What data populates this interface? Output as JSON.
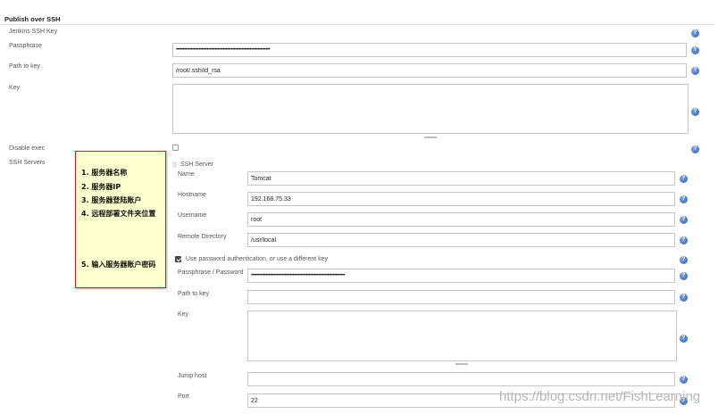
{
  "section": {
    "title": "Publish over SSH"
  },
  "global": {
    "jenkins_ssh_key_label": "Jenkins SSH Key",
    "passphrase_label": "Passphrase",
    "passphrase_value": "••••••••••••••••••••••••••••••••••••••••••••••••••••••••••••••••••••••",
    "path_to_key_label": "Path to key",
    "path_to_key_value": "/root/.ssh/id_rsa",
    "key_label": "Key",
    "key_value": "",
    "disable_exec_label": "Disable exec",
    "ssh_servers_label": "SSH Servers"
  },
  "server": {
    "header": "SSH Server",
    "name_label": "Name",
    "name_value": "Tomcat",
    "hostname_label": "Hostname",
    "hostname_value": "192.168.75.33",
    "username_label": "Username",
    "username_value": "root",
    "remote_dir_label": "Remote Directory",
    "remote_dir_value": "/usr/local",
    "use_password_label": "Use password authentication, or use a different key",
    "passphrase_label": "Passphrase / Password",
    "passphrase_value": "••••••••••••••••••••••••••••••••••••••••••••••••••••••••••••••••••••••",
    "path_to_key_label": "Path to key",
    "path_to_key_value": "",
    "key_label": "Key",
    "key_value": "",
    "jump_host_label": "Jump host",
    "jump_host_value": "",
    "port_label": "Port",
    "port_value": "22"
  },
  "help_glyph": "?",
  "annotation": {
    "line1": "1. 服务器名称",
    "line2": "2. 服务器IP",
    "line3": "3. 服务器登陆账户",
    "line4": "4. 远程部署文件夹位置",
    "line5": "5. 输入服务器账户密码"
  },
  "watermark": "https://blog.csdn.net/FishLearning",
  "colors": {
    "help_icon": "#2d5fb3",
    "note_border": "#c81e1e",
    "note_bg": "#ffffd0"
  }
}
